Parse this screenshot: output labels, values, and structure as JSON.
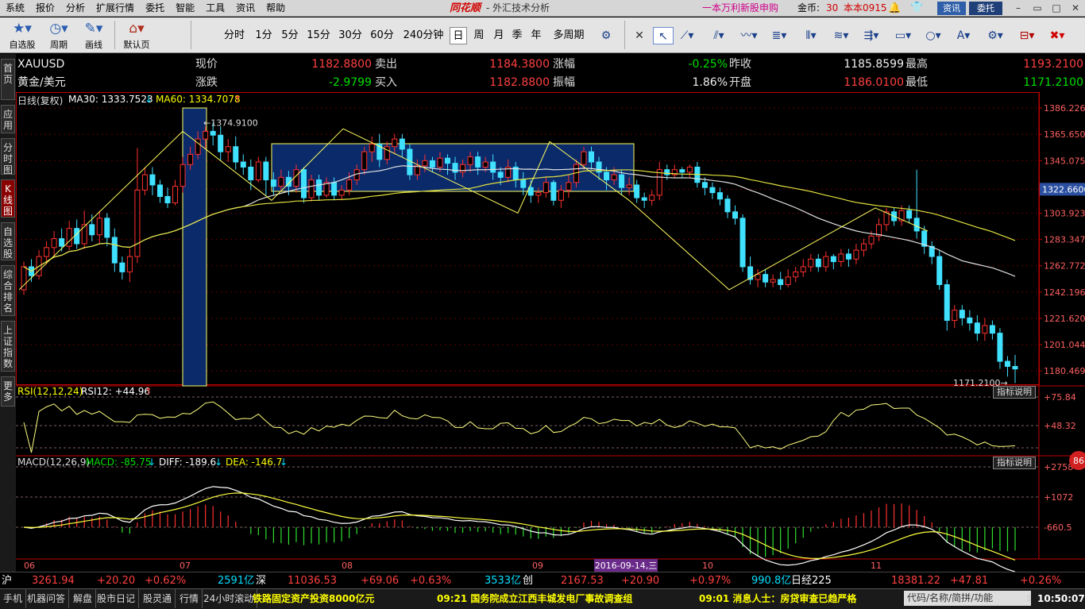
{
  "menu": {
    "items": [
      "系统",
      "报价",
      "分析",
      "扩展行情",
      "委托",
      "智能",
      "工具",
      "资讯",
      "帮助"
    ],
    "brand": "同花顺",
    "title": "- 外汇技术分析",
    "promo": "一本万利新股申购",
    "coin_label": "金币:",
    "coin_value": "30",
    "user": "本本0915",
    "news_btn": "资讯",
    "entrust_btn": "委托"
  },
  "toolbar": {
    "self_select": "自选股",
    "period": "周期",
    "draw": "画线",
    "default_page": "默认页",
    "periods": [
      "分时",
      "1分",
      "5分",
      "15分",
      "30分",
      "60分",
      "240分钟",
      "日",
      "周",
      "月",
      "季",
      "年",
      "多周期"
    ],
    "active_period": "日"
  },
  "left_tabs": [
    {
      "label": "首页",
      "active": false
    },
    {
      "label": "应用",
      "active": false
    },
    {
      "label": "分时图",
      "active": false
    },
    {
      "label": "K线图",
      "active": true
    },
    {
      "label": "自选股",
      "active": false
    },
    {
      "label": "综合排名",
      "active": false
    },
    {
      "label": "上证指数",
      "active": false
    },
    {
      "label": "更多",
      "active": false
    }
  ],
  "quote": {
    "symbol": "XAUUSD",
    "name": "黄金/美元",
    "price_label": "现价",
    "price": "1182.8800",
    "sell_label": "卖出",
    "sell": "1184.3800",
    "chg_pct_label": "涨幅",
    "chg_pct": "-0.25%",
    "prev_close_label": "昨收",
    "prev_close": "1185.8599",
    "high_label": "最高",
    "high": "1193.2100",
    "chg_label": "涨跌",
    "chg": "-2.9799",
    "buy_label": "买入",
    "buy": "1182.8800",
    "amp_label": "振幅",
    "amp": "1.86%",
    "open_label": "开盘",
    "open": "1186.0100",
    "low_label": "最低",
    "low": "1171.2100"
  },
  "main_panel": {
    "title": "日线(复权)",
    "ma30_label": "MA30: 1333.7523",
    "ma60_label": "MA60: 1334.7078",
    "high_mark": "1374.9100",
    "low_mark": "1171.2100",
    "current_tag": "1322.6600"
  },
  "rsi_panel": {
    "title": "RSI(12,12,24)",
    "value": "RSI12: +44.96",
    "explain": "指标说明"
  },
  "macd_panel": {
    "title": "MACD(12,26,9)",
    "macd": "MACD: -85.75",
    "diff": "DIFF: -189.6",
    "dea": "DEA: -146.7",
    "explain": "指标说明",
    "badge": "86"
  },
  "status1": {
    "sh_label": "沪",
    "sh_value": "3261.94",
    "sh_chg": "+20.20",
    "sh_pct": "+0.62%",
    "sh_vol": "2591亿",
    "sz_label": "深",
    "sz_value": "11036.53",
    "sz_chg": "+69.06",
    "sz_pct": "+0.63%",
    "sz_vol": "3533亿",
    "cy_label": "创",
    "cy_value": "2167.53",
    "cy_chg": "+20.90",
    "cy_pct": "+0.97%",
    "cy_vol": "990.8亿",
    "nk_label": "日经225",
    "nk_value": "18381.22",
    "nk_chg": "+47.81",
    "nk_pct": "+0.26%"
  },
  "status2": {
    "buttons": [
      "手机",
      "机器问答",
      "解盘",
      "股市日记",
      "股灵通",
      "行情",
      "24小时滚动"
    ],
    "news1": "铁路固定资产投资8000亿元",
    "news2": "09:21 国务院成立江西丰城发电厂事故调查组",
    "news3": "09:01 消息人士：房贷审查已趋严格",
    "search_placeholder": "代码/名称/简拼/功能",
    "clock": "10:50:07"
  },
  "chart_data": {
    "type": "candlestick",
    "y_ticks": [
      1386.2267,
      1365.6504,
      1345.0752,
      1322.66,
      1303.9239,
      1283.3476,
      1262.7723,
      1242.1963,
      1221.62,
      1201.0448,
      1180.4692
    ],
    "ylim": [
      1170,
      1390
    ],
    "x_ticks": [
      "06",
      "07",
      "08",
      "09",
      "10",
      "11"
    ],
    "cursor_date": "2016-09-14,三",
    "candles": [
      [
        1244,
        1262,
        1240,
        1266
      ],
      [
        1262,
        1255,
        1250,
        1268
      ],
      [
        1255,
        1270,
        1252,
        1275
      ],
      [
        1270,
        1277,
        1264,
        1282
      ],
      [
        1277,
        1284,
        1270,
        1290
      ],
      [
        1284,
        1278,
        1274,
        1292
      ],
      [
        1278,
        1292,
        1275,
        1298
      ],
      [
        1292,
        1280,
        1276,
        1299
      ],
      [
        1280,
        1295,
        1276,
        1306
      ],
      [
        1295,
        1287,
        1282,
        1303
      ],
      [
        1287,
        1300,
        1280,
        1306
      ],
      [
        1300,
        1285,
        1278,
        1304
      ],
      [
        1285,
        1265,
        1258,
        1292
      ],
      [
        1265,
        1258,
        1252,
        1270
      ],
      [
        1258,
        1270,
        1250,
        1276
      ],
      [
        1270,
        1322,
        1265,
        1355
      ],
      [
        1322,
        1334,
        1318,
        1340
      ],
      [
        1334,
        1326,
        1318,
        1340
      ],
      [
        1326,
        1317,
        1312,
        1330
      ],
      [
        1317,
        1312,
        1308,
        1324
      ],
      [
        1312,
        1325,
        1310,
        1330
      ],
      [
        1325,
        1342,
        1320,
        1348
      ],
      [
        1342,
        1350,
        1338,
        1356
      ],
      [
        1350,
        1362,
        1346,
        1368
      ],
      [
        1362,
        1368,
        1354,
        1372
      ],
      [
        1368,
        1365,
        1357,
        1375
      ],
      [
        1365,
        1352,
        1345,
        1372
      ],
      [
        1352,
        1356,
        1344,
        1362
      ],
      [
        1356,
        1344,
        1338,
        1364
      ],
      [
        1344,
        1340,
        1334,
        1350
      ],
      [
        1340,
        1330,
        1322,
        1346
      ],
      [
        1330,
        1344,
        1328,
        1348
      ],
      [
        1344,
        1330,
        1318,
        1348
      ],
      [
        1330,
        1325,
        1318,
        1336
      ],
      [
        1325,
        1332,
        1322,
        1338
      ],
      [
        1332,
        1325,
        1318,
        1337
      ],
      [
        1325,
        1338,
        1320,
        1342
      ],
      [
        1338,
        1316,
        1312,
        1340
      ],
      [
        1316,
        1330,
        1313,
        1334
      ],
      [
        1330,
        1318,
        1314,
        1334
      ],
      [
        1318,
        1328,
        1316,
        1332
      ],
      [
        1328,
        1318,
        1314,
        1332
      ],
      [
        1318,
        1322,
        1314,
        1326
      ],
      [
        1322,
        1330,
        1318,
        1336
      ],
      [
        1330,
        1338,
        1326,
        1342
      ],
      [
        1338,
        1352,
        1334,
        1356
      ],
      [
        1352,
        1358,
        1344,
        1364
      ],
      [
        1358,
        1346,
        1340,
        1366
      ],
      [
        1346,
        1356,
        1342,
        1360
      ],
      [
        1356,
        1362,
        1350,
        1366
      ],
      [
        1362,
        1354,
        1348,
        1366
      ],
      [
        1354,
        1334,
        1330,
        1358
      ],
      [
        1334,
        1341,
        1330,
        1346
      ],
      [
        1341,
        1345,
        1336,
        1350
      ],
      [
        1345,
        1340,
        1336,
        1348
      ],
      [
        1340,
        1347,
        1336,
        1352
      ],
      [
        1347,
        1343,
        1334,
        1350
      ],
      [
        1343,
        1336,
        1330,
        1348
      ],
      [
        1336,
        1342,
        1332,
        1346
      ],
      [
        1342,
        1348,
        1336,
        1352
      ],
      [
        1348,
        1340,
        1334,
        1352
      ],
      [
        1340,
        1344,
        1336,
        1348
      ],
      [
        1344,
        1336,
        1330,
        1350
      ],
      [
        1336,
        1332,
        1326,
        1340
      ],
      [
        1332,
        1340,
        1328,
        1346
      ],
      [
        1340,
        1330,
        1324,
        1344
      ],
      [
        1330,
        1324,
        1318,
        1336
      ],
      [
        1324,
        1318,
        1312,
        1330
      ],
      [
        1318,
        1320,
        1312,
        1324
      ],
      [
        1320,
        1328,
        1316,
        1332
      ],
      [
        1328,
        1314,
        1310,
        1330
      ],
      [
        1314,
        1322,
        1308,
        1326
      ],
      [
        1322,
        1328,
        1316,
        1334
      ],
      [
        1328,
        1342,
        1324,
        1346
      ],
      [
        1342,
        1352,
        1338,
        1356
      ],
      [
        1352,
        1344,
        1338,
        1356
      ],
      [
        1344,
        1336,
        1330,
        1348
      ],
      [
        1336,
        1330,
        1322,
        1340
      ],
      [
        1330,
        1334,
        1326,
        1340
      ],
      [
        1334,
        1324,
        1318,
        1338
      ],
      [
        1324,
        1326,
        1318,
        1332
      ],
      [
        1326,
        1316,
        1312,
        1330
      ],
      [
        1316,
        1314,
        1308,
        1320
      ],
      [
        1314,
        1318,
        1310,
        1322
      ],
      [
        1318,
        1338,
        1314,
        1344
      ],
      [
        1338,
        1334,
        1330,
        1342
      ],
      [
        1334,
        1338,
        1332,
        1342
      ],
      [
        1338,
        1336,
        1332,
        1340
      ],
      [
        1336,
        1340,
        1332,
        1342
      ],
      [
        1340,
        1328,
        1324,
        1344
      ],
      [
        1328,
        1324,
        1318,
        1332
      ],
      [
        1324,
        1320,
        1315,
        1328
      ],
      [
        1320,
        1315,
        1310,
        1324
      ],
      [
        1315,
        1305,
        1300,
        1318
      ],
      [
        1305,
        1300,
        1295,
        1310
      ],
      [
        1300,
        1262,
        1258,
        1303
      ],
      [
        1262,
        1252,
        1248,
        1270
      ],
      [
        1252,
        1256,
        1246,
        1260
      ],
      [
        1256,
        1250,
        1246,
        1260
      ],
      [
        1250,
        1252,
        1246,
        1256
      ],
      [
        1252,
        1248,
        1244,
        1258
      ],
      [
        1248,
        1254,
        1246,
        1260
      ],
      [
        1254,
        1258,
        1250,
        1262
      ],
      [
        1258,
        1262,
        1254,
        1268
      ],
      [
        1262,
        1268,
        1258,
        1272
      ],
      [
        1268,
        1262,
        1258,
        1272
      ],
      [
        1262,
        1270,
        1258,
        1274
      ],
      [
        1270,
        1266,
        1260,
        1272
      ],
      [
        1266,
        1272,
        1262,
        1276
      ],
      [
        1272,
        1268,
        1262,
        1276
      ],
      [
        1268,
        1275,
        1264,
        1280
      ],
      [
        1275,
        1280,
        1270,
        1284
      ],
      [
        1280,
        1286,
        1276,
        1290
      ],
      [
        1286,
        1295,
        1282,
        1300
      ],
      [
        1295,
        1305,
        1290,
        1308
      ],
      [
        1305,
        1298,
        1294,
        1308
      ],
      [
        1298,
        1306,
        1294,
        1310
      ],
      [
        1306,
        1300,
        1296,
        1310
      ],
      [
        1300,
        1290,
        1284,
        1338
      ],
      [
        1290,
        1278,
        1272,
        1294
      ],
      [
        1278,
        1270,
        1264,
        1282
      ],
      [
        1270,
        1248,
        1244,
        1275
      ],
      [
        1248,
        1220,
        1212,
        1252
      ],
      [
        1220,
        1228,
        1214,
        1232
      ],
      [
        1228,
        1222,
        1216,
        1232
      ],
      [
        1222,
        1218,
        1212,
        1228
      ],
      [
        1218,
        1210,
        1204,
        1224
      ],
      [
        1210,
        1216,
        1204,
        1222
      ],
      [
        1216,
        1210,
        1205,
        1220
      ],
      [
        1210,
        1188,
        1182,
        1214
      ],
      [
        1188,
        1184,
        1176,
        1192
      ],
      [
        1184,
        1182,
        1171,
        1193
      ]
    ],
    "rsi_levels": [
      "+75.84",
      "+48.32"
    ],
    "macd_levels": [
      "+2758",
      "+1072",
      "-660.5"
    ]
  }
}
